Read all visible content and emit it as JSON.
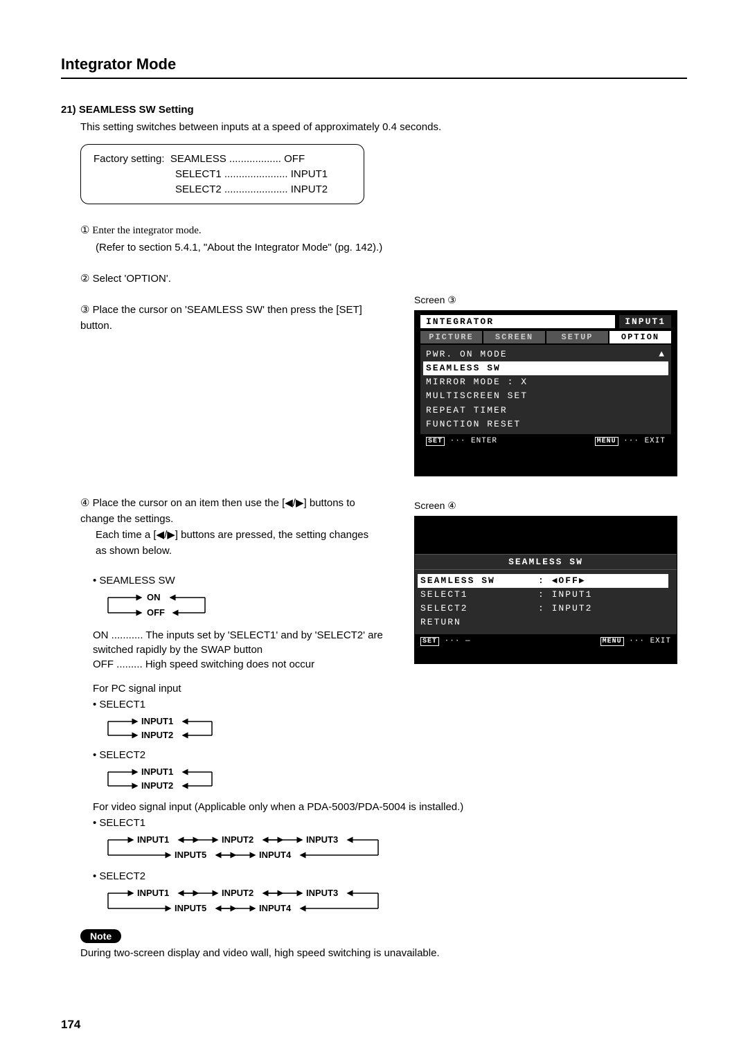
{
  "page_title": "Integrator Mode",
  "section_heading": "21) SEAMLESS SW Setting",
  "intro": "This setting switches between inputs at a speed of approximately 0.4 seconds.",
  "factory": {
    "label": "Factory setting:",
    "l1a": "SEAMLESS",
    "l1b": "OFF",
    "l2a": "SELECT1",
    "l2b": "INPUT1",
    "l3a": "SELECT2",
    "l3b": "INPUT2"
  },
  "steps": {
    "s1a": "① Enter the integrator mode.",
    "s1b": "(Refer to section 5.4.1, \"About the Integrator Mode\" (pg. 142).)",
    "s2": "② Select 'OPTION'.",
    "s3": "③ Place the cursor on 'SEAMLESS SW' then press the [SET] button.",
    "s4a": "④ Place the cursor on an item then use the [◀/▶] buttons to change the settings.",
    "s4b": "Each time a [◀/▶] buttons are pressed, the setting changes as shown below."
  },
  "sub": {
    "seamless_label": "• SEAMLESS SW",
    "on": "ON",
    "off": "OFF",
    "on_def": "ON ........... The inputs set by 'SELECT1' and by 'SELECT2' are switched rapidly by the SWAP button",
    "off_def": "OFF ......... High speed switching does not occur",
    "pc_label": "For PC signal input",
    "sel1": "• SELECT1",
    "sel2": "• SELECT2",
    "in1": "INPUT1",
    "in2": "INPUT2",
    "in3": "INPUT3",
    "in4": "INPUT4",
    "in5": "INPUT5",
    "video_label": "For video signal input (Applicable only when a PDA-5003/PDA-5004 is installed.)"
  },
  "note_label": "Note",
  "note_text": "During two-screen display and video wall, high speed switching is unavailable.",
  "page_number": "174",
  "screen3": {
    "label": "Screen ③",
    "title_left": "INTEGRATOR",
    "title_right": "INPUT1",
    "tabs": [
      "PICTURE",
      "SCREEN",
      "SETUP",
      "OPTION"
    ],
    "items": {
      "l1": "PWR. ON  MODE",
      "l2": "SEAMLESS  SW",
      "l3": "MIRROR  MODE        :   X",
      "l4": "MULTISCREEN  SET",
      "l5": "REPEAT  TIMER",
      "l6": "FUNCTION  RESET"
    },
    "footer_left": "SET ··· ENTER",
    "footer_right": "MENU ··· EXIT"
  },
  "screen4": {
    "label": "Screen ④",
    "header": "SEAMLESS  SW",
    "rows": {
      "r1k": "SEAMLESS SW",
      "r1v": ": ◀OFF▶",
      "r2k": "  SELECT1",
      "r2v": ":  INPUT1",
      "r3k": "  SELECT2",
      "r3v": ":  INPUT2",
      "r4": "RETURN"
    },
    "footer_left": "SET ··· —",
    "footer_right": "MENU ··· EXIT"
  }
}
